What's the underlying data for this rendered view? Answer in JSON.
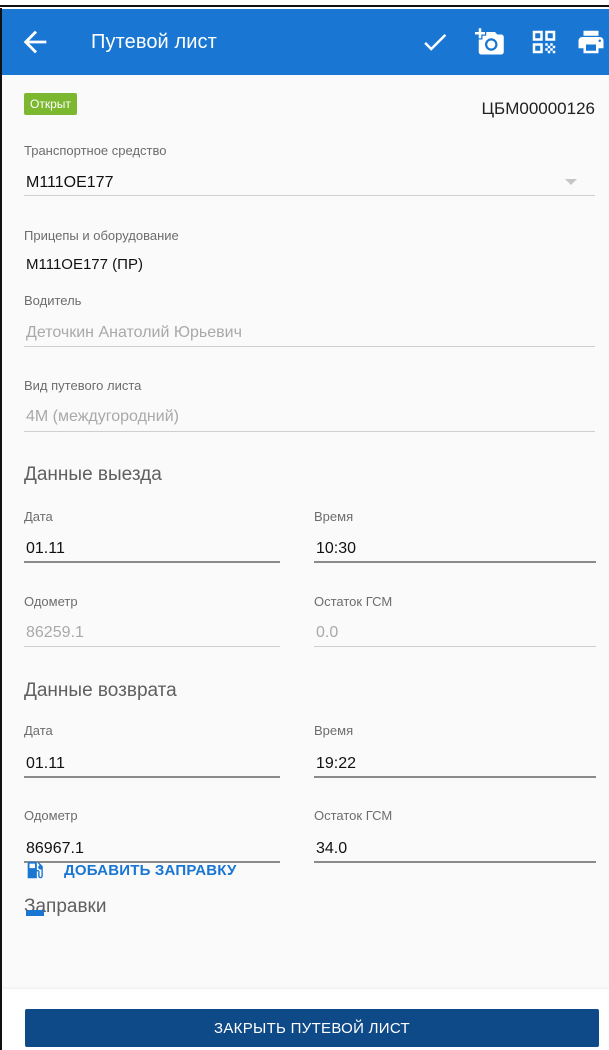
{
  "colors": {
    "primary": "#1976D2",
    "badge_open": "#7CB82F",
    "button_close": "#0E4A87"
  },
  "appbar": {
    "title": "Путевой лист",
    "icons": [
      "back-arrow-icon",
      "checkmark-icon",
      "add-photo-icon",
      "qr-code-icon",
      "print-icon"
    ]
  },
  "header": {
    "status": "Открыт",
    "number": "ЦБМ00000126"
  },
  "vehicle": {
    "label": "Транспортное средство",
    "value": "М111ОЕ177"
  },
  "trailers": {
    "label": "Прицепы и оборудование",
    "value": "М111ОЕ177 (ПР)"
  },
  "driver": {
    "label": "Водитель",
    "value": "Деточкин Анатолий Юрьевич"
  },
  "waybill_type": {
    "label": "Вид путевого листа",
    "value": "4М (междугородний)"
  },
  "departure": {
    "title": "Данные выезда",
    "date_label": "Дата",
    "date_value": "01.11",
    "time_label": "Время",
    "time_value": "10:30",
    "odometer_label": "Одометр",
    "odometer_value": "86259.1",
    "fuel_label": "Остаток ГСМ",
    "fuel_value": "0.0"
  },
  "return": {
    "title": "Данные возврата",
    "date_label": "Дата",
    "date_value": "01.11",
    "time_label": "Время",
    "time_value": "19:22",
    "odometer_label": "Одометр",
    "odometer_value": "86967.1",
    "fuel_label": "Остаток ГСМ",
    "fuel_value": "34.0"
  },
  "refuels": {
    "title": "Заправки",
    "add_label": "ДОБАВИТЬ ЗАПРАВКУ"
  },
  "footer": {
    "close_label": "ЗАКРЫТЬ ПУТЕВОЙ ЛИСТ"
  }
}
